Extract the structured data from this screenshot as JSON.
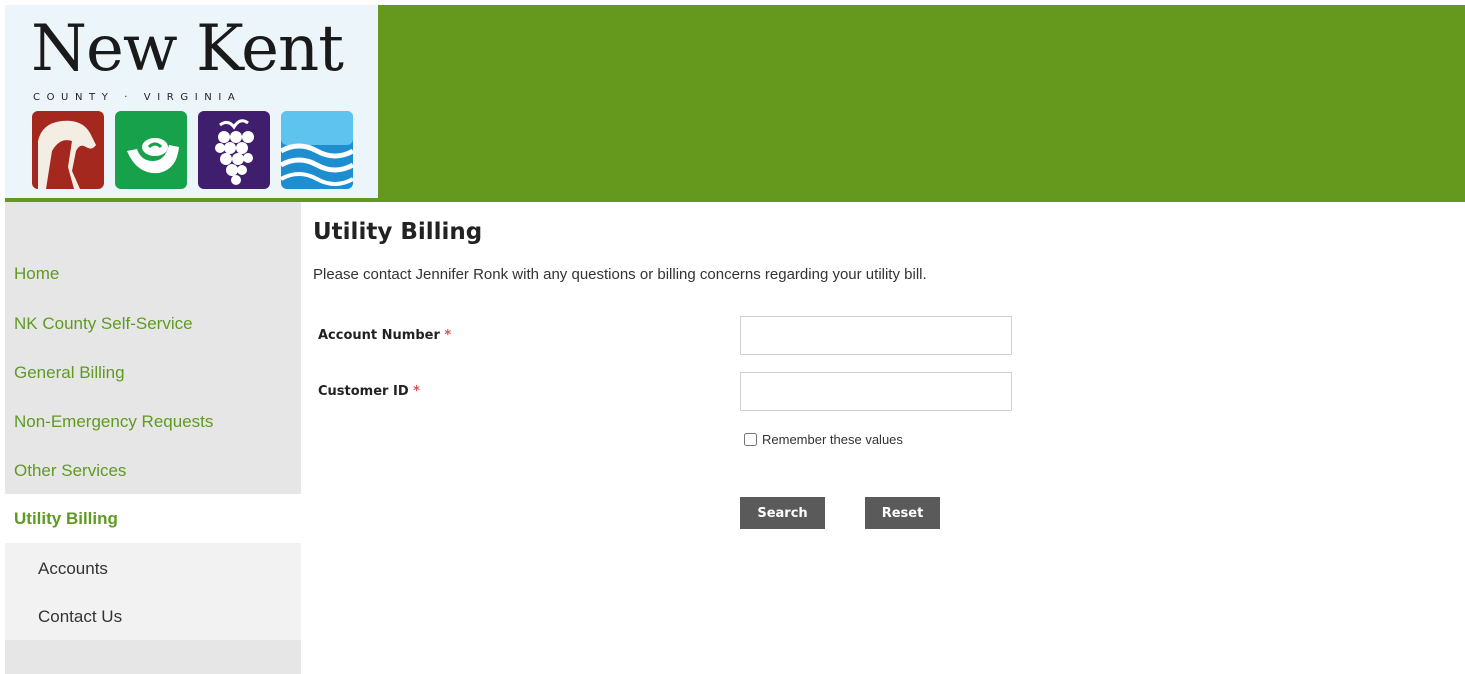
{
  "logo": {
    "title": "New Kent",
    "subtitle": "COUNTY · VIRGINIA"
  },
  "sidebar": {
    "items": [
      {
        "label": "Home"
      },
      {
        "label": "NK County Self-Service"
      },
      {
        "label": "General Billing"
      },
      {
        "label": "Non-Emergency Requests"
      },
      {
        "label": "Other Services"
      },
      {
        "label": "Utility Billing"
      }
    ],
    "sub_items": [
      {
        "label": "Accounts"
      },
      {
        "label": "Contact Us"
      }
    ]
  },
  "main": {
    "title": "Utility Billing",
    "intro": "Please contact Jennifer Ronk with any questions or billing concerns regarding your utility bill.",
    "fields": [
      {
        "label": "Account Number",
        "required_mark": "*",
        "value": ""
      },
      {
        "label": "Customer ID",
        "required_mark": "*",
        "value": ""
      }
    ],
    "remember_label": "Remember these values",
    "remember_checked": false,
    "search_label": "Search",
    "reset_label": "Reset"
  },
  "colors": {
    "brand_green": "#64991d",
    "link_green": "#5f9a22",
    "button_gray": "#5a5a5a",
    "required_red": "#d9534f"
  },
  "icons": [
    "horse-icon",
    "hand-leaf-icon",
    "grapes-icon",
    "water-waves-icon"
  ]
}
